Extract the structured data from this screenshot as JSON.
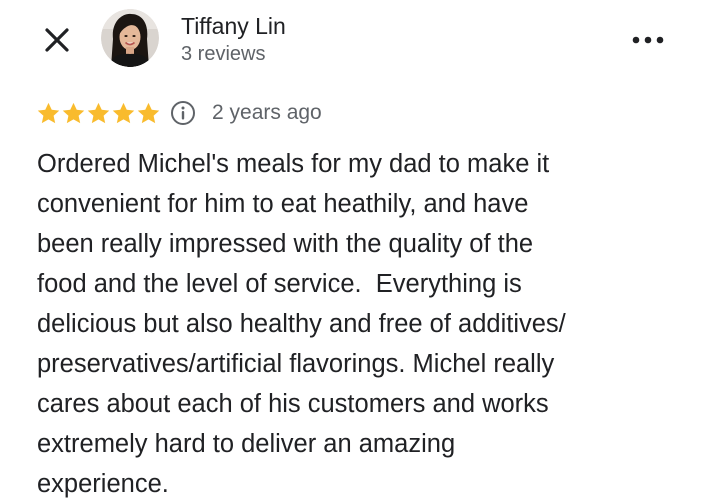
{
  "review": {
    "author": {
      "name": "Tiffany Lin",
      "meta": "3 reviews"
    },
    "rating": 5,
    "rating_max": 5,
    "date": "2 years ago",
    "text_lines": [
      "Ordered Michel's meals for my dad to make it",
      "convenient for him to eat heathily, and have",
      "been really impressed with the quality of the",
      "food and the level of service.  Everything is",
      "delicious but also healthy and free of additives/",
      "preservatives/artificial flavorings. Michel really",
      "cares about each of his customers and works",
      "extremely hard to deliver an amazing",
      "experience."
    ]
  },
  "icons": {
    "close": "close-icon",
    "more": "more-vertical-dots-icon",
    "star": "star-icon",
    "info": "info-icon"
  },
  "colors": {
    "star": "#F9BB2D",
    "primary_text": "#202124",
    "secondary_text": "#5f6368"
  }
}
